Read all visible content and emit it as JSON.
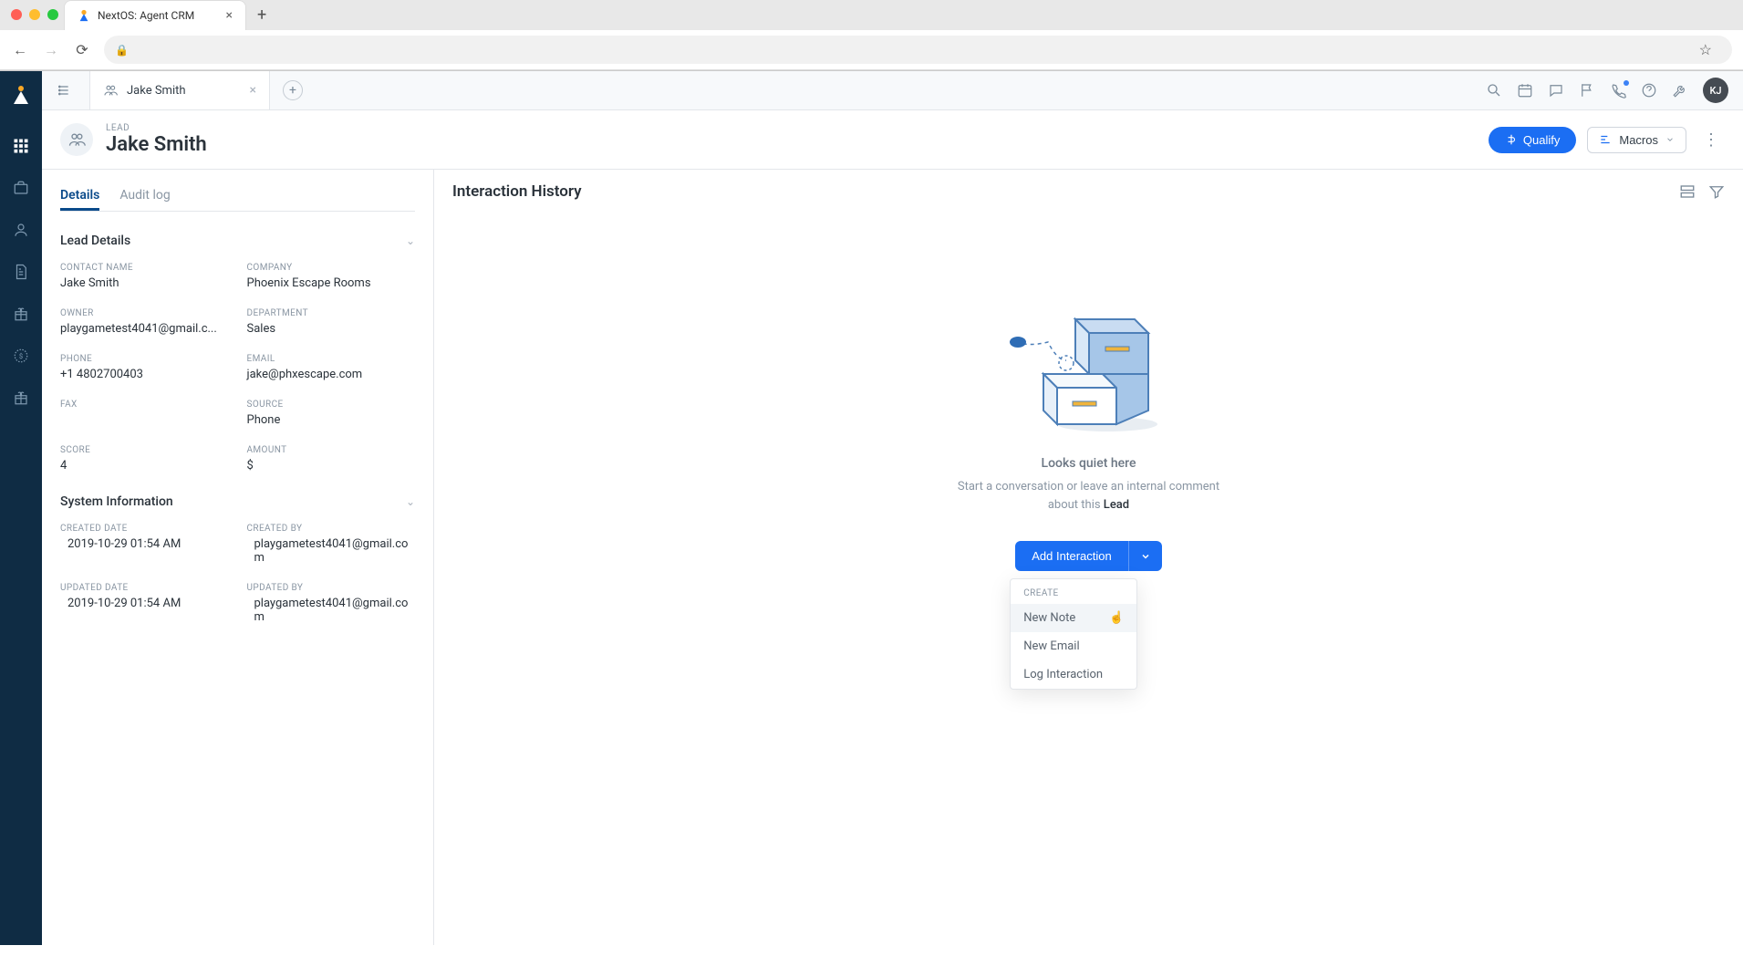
{
  "browser": {
    "tab_title": "NextOS: Agent CRM"
  },
  "recordTab": {
    "name": "Jake Smith"
  },
  "toolbar": {
    "avatar_initials": "KJ"
  },
  "pageHeader": {
    "entity_type": "LEAD",
    "entity_name": "Jake Smith",
    "qualify_label": "Qualify",
    "macros_label": "Macros"
  },
  "detailTabs": {
    "details": "Details",
    "audit": "Audit log"
  },
  "sections": {
    "lead": {
      "title": "Lead Details",
      "contact_name_label": "CONTACT NAME",
      "contact_name": "Jake Smith",
      "company_label": "COMPANY",
      "company": "Phoenix Escape Rooms",
      "owner_label": "OWNER",
      "owner": "playgametest4041@gmail.c...",
      "department_label": "DEPARTMENT",
      "department": "Sales",
      "phone_label": "PHONE",
      "phone": "+1 4802700403",
      "email_label": "EMAIL",
      "email": "jake@phxescape.com",
      "fax_label": "FAX",
      "fax": "",
      "source_label": "SOURCE",
      "source": "Phone",
      "score_label": "SCORE",
      "score": "4",
      "amount_label": "AMOUNT",
      "amount": "$"
    },
    "system": {
      "title": "System Information",
      "created_date_label": "CREATED DATE",
      "created_date": "2019-10-29 01:54 AM",
      "created_by_label": "CREATED BY",
      "created_by": "playgametest4041@gmail.com",
      "updated_date_label": "UPDATED DATE",
      "updated_date": "2019-10-29 01:54 AM",
      "updated_by_label": "UPDATED BY",
      "updated_by": "playgametest4041@gmail.com"
    }
  },
  "history": {
    "title": "Interaction History",
    "empty_title": "Looks quiet here",
    "empty_sub_prefix": "Start a conversation or leave an internal comment about this ",
    "empty_sub_entity": "Lead",
    "add_button": "Add Interaction",
    "dropdown": {
      "header": "CREATE",
      "new_note": "New Note",
      "new_email": "New Email",
      "log_interaction": "Log Interaction"
    }
  }
}
